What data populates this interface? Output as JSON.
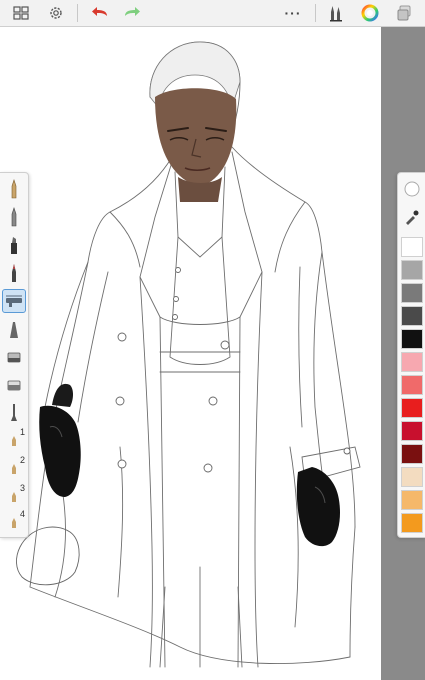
{
  "toolbar": {
    "items": [
      {
        "name": "grid-view-icon"
      },
      {
        "name": "settings-icon"
      },
      {
        "name": "undo-icon",
        "color": "#d83a2e"
      },
      {
        "name": "redo-icon",
        "color": "#7fcf7f"
      },
      {
        "name": "more-options-icon"
      },
      {
        "name": "brush-library-icon"
      },
      {
        "name": "color-wheel-icon"
      },
      {
        "name": "layers-icon"
      }
    ],
    "more_label": "···"
  },
  "brush_panel": {
    "tools": [
      {
        "name": "pencil-brush-icon"
      },
      {
        "name": "ballpoint-pen-icon"
      },
      {
        "name": "marker-icon"
      },
      {
        "name": "paintbrush-icon"
      },
      {
        "name": "airbrush-icon",
        "selected": true
      },
      {
        "name": "smudge-icon"
      },
      {
        "name": "eraser-icon"
      },
      {
        "name": "fill-tool-icon"
      },
      {
        "name": "smear-brush-icon"
      }
    ],
    "presets": [
      {
        "label": "1"
      },
      {
        "label": "2"
      },
      {
        "label": "3"
      },
      {
        "label": "4"
      }
    ]
  },
  "color_panel": {
    "tools": [
      {
        "name": "color-puck-icon"
      },
      {
        "name": "eyedropper-icon"
      }
    ],
    "swatches": [
      "#ffffff",
      "#a6a6a6",
      "#7a7a7a",
      "#4a4a4a",
      "#111111",
      "#f7a8b0",
      "#f06a6a",
      "#e81e1e",
      "#c8102e",
      "#7a1010",
      "#f3dcc0",
      "#f5b86a",
      "#f39a1e"
    ]
  },
  "colors": {
    "toolbar_bg": "#f2f2f2",
    "canvas_bg": "#ffffff",
    "gutter": "#8a8a8a",
    "skin": "#7a5a48",
    "glove": "#111111",
    "sketch_line": "#555555"
  }
}
